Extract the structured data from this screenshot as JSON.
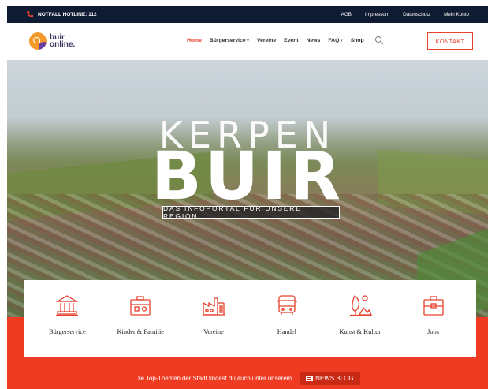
{
  "topbar": {
    "hotline": "NOTFALL HOTLINE: 112",
    "links": [
      "AGB",
      "Impressum",
      "Datenschutz",
      "Mein Konto"
    ]
  },
  "header": {
    "logo_line1": "buir",
    "logo_line2": "online.",
    "nav": [
      {
        "label": "Home",
        "active": true
      },
      {
        "label": "Bürgerservice",
        "dropdown": true
      },
      {
        "label": "Vereine"
      },
      {
        "label": "Event"
      },
      {
        "label": "News"
      },
      {
        "label": "FAQ",
        "dropdown": true
      },
      {
        "label": "Shop"
      }
    ],
    "contact_button": "KONTAKT"
  },
  "hero": {
    "title_small": "KERPEN",
    "title_big": "BUIR",
    "tagline": "DAS INFOPORTAL FÜR UNSERE REGION"
  },
  "categories": [
    {
      "label": "Bürgerservice",
      "icon": "town-hall-icon"
    },
    {
      "label": "Kinder & Familie",
      "icon": "toybox-icon"
    },
    {
      "label": "Vereine",
      "icon": "building-icon"
    },
    {
      "label": "Handel",
      "icon": "bus-icon"
    },
    {
      "label": "Kunst & Kultur",
      "icon": "art-icon"
    },
    {
      "label": "Jobs",
      "icon": "briefcase-icon"
    }
  ],
  "footer_strip": {
    "text": "Die Top-Themen der Stadt findest du auch unter unserem",
    "button": "NEWS BLOG"
  },
  "colors": {
    "accent": "#e8412e",
    "topbar": "#0f1a33",
    "band": "#ee3b22"
  }
}
